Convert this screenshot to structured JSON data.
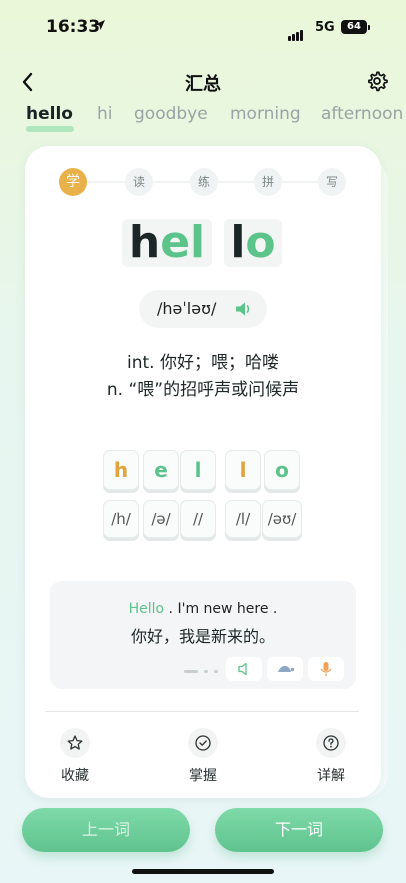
{
  "status": {
    "time": "16:33",
    "network": "5G",
    "battery": "64"
  },
  "nav": {
    "title": "汇总"
  },
  "word_tabs": [
    {
      "label": "hello",
      "active": true
    },
    {
      "label": "hi"
    },
    {
      "label": "goodbye"
    },
    {
      "label": "morning"
    },
    {
      "label": "afternoon"
    }
  ],
  "steps": [
    "学",
    "读",
    "练",
    "拼",
    "写"
  ],
  "word": {
    "syllable1": {
      "dark": "h",
      "green": "el"
    },
    "syllable2": {
      "dark": "l",
      "green": "o"
    },
    "phonetic": "/həˈləʊ/"
  },
  "definitions": [
    "int. 你好；喂；哈喽",
    "n. “喂”的招呼声或问候声"
  ],
  "letter_tiles": [
    "h",
    "e",
    "l",
    "l",
    "o"
  ],
  "phoneme_tiles": [
    "/h/",
    "/ə/",
    "//",
    "/l/",
    "/əʊ/"
  ],
  "example": {
    "highlight": "Hello",
    "rest": " . I'm new here .",
    "translation": "你好，我是新来的。"
  },
  "actions": {
    "favorite": "收藏",
    "mastered": "掌握",
    "details": "详解"
  },
  "buttons": {
    "prev": "上一词",
    "next": "下一词"
  },
  "colors": {
    "accent_green": "#5cc38a",
    "accent_orange": "#e9b14a"
  }
}
